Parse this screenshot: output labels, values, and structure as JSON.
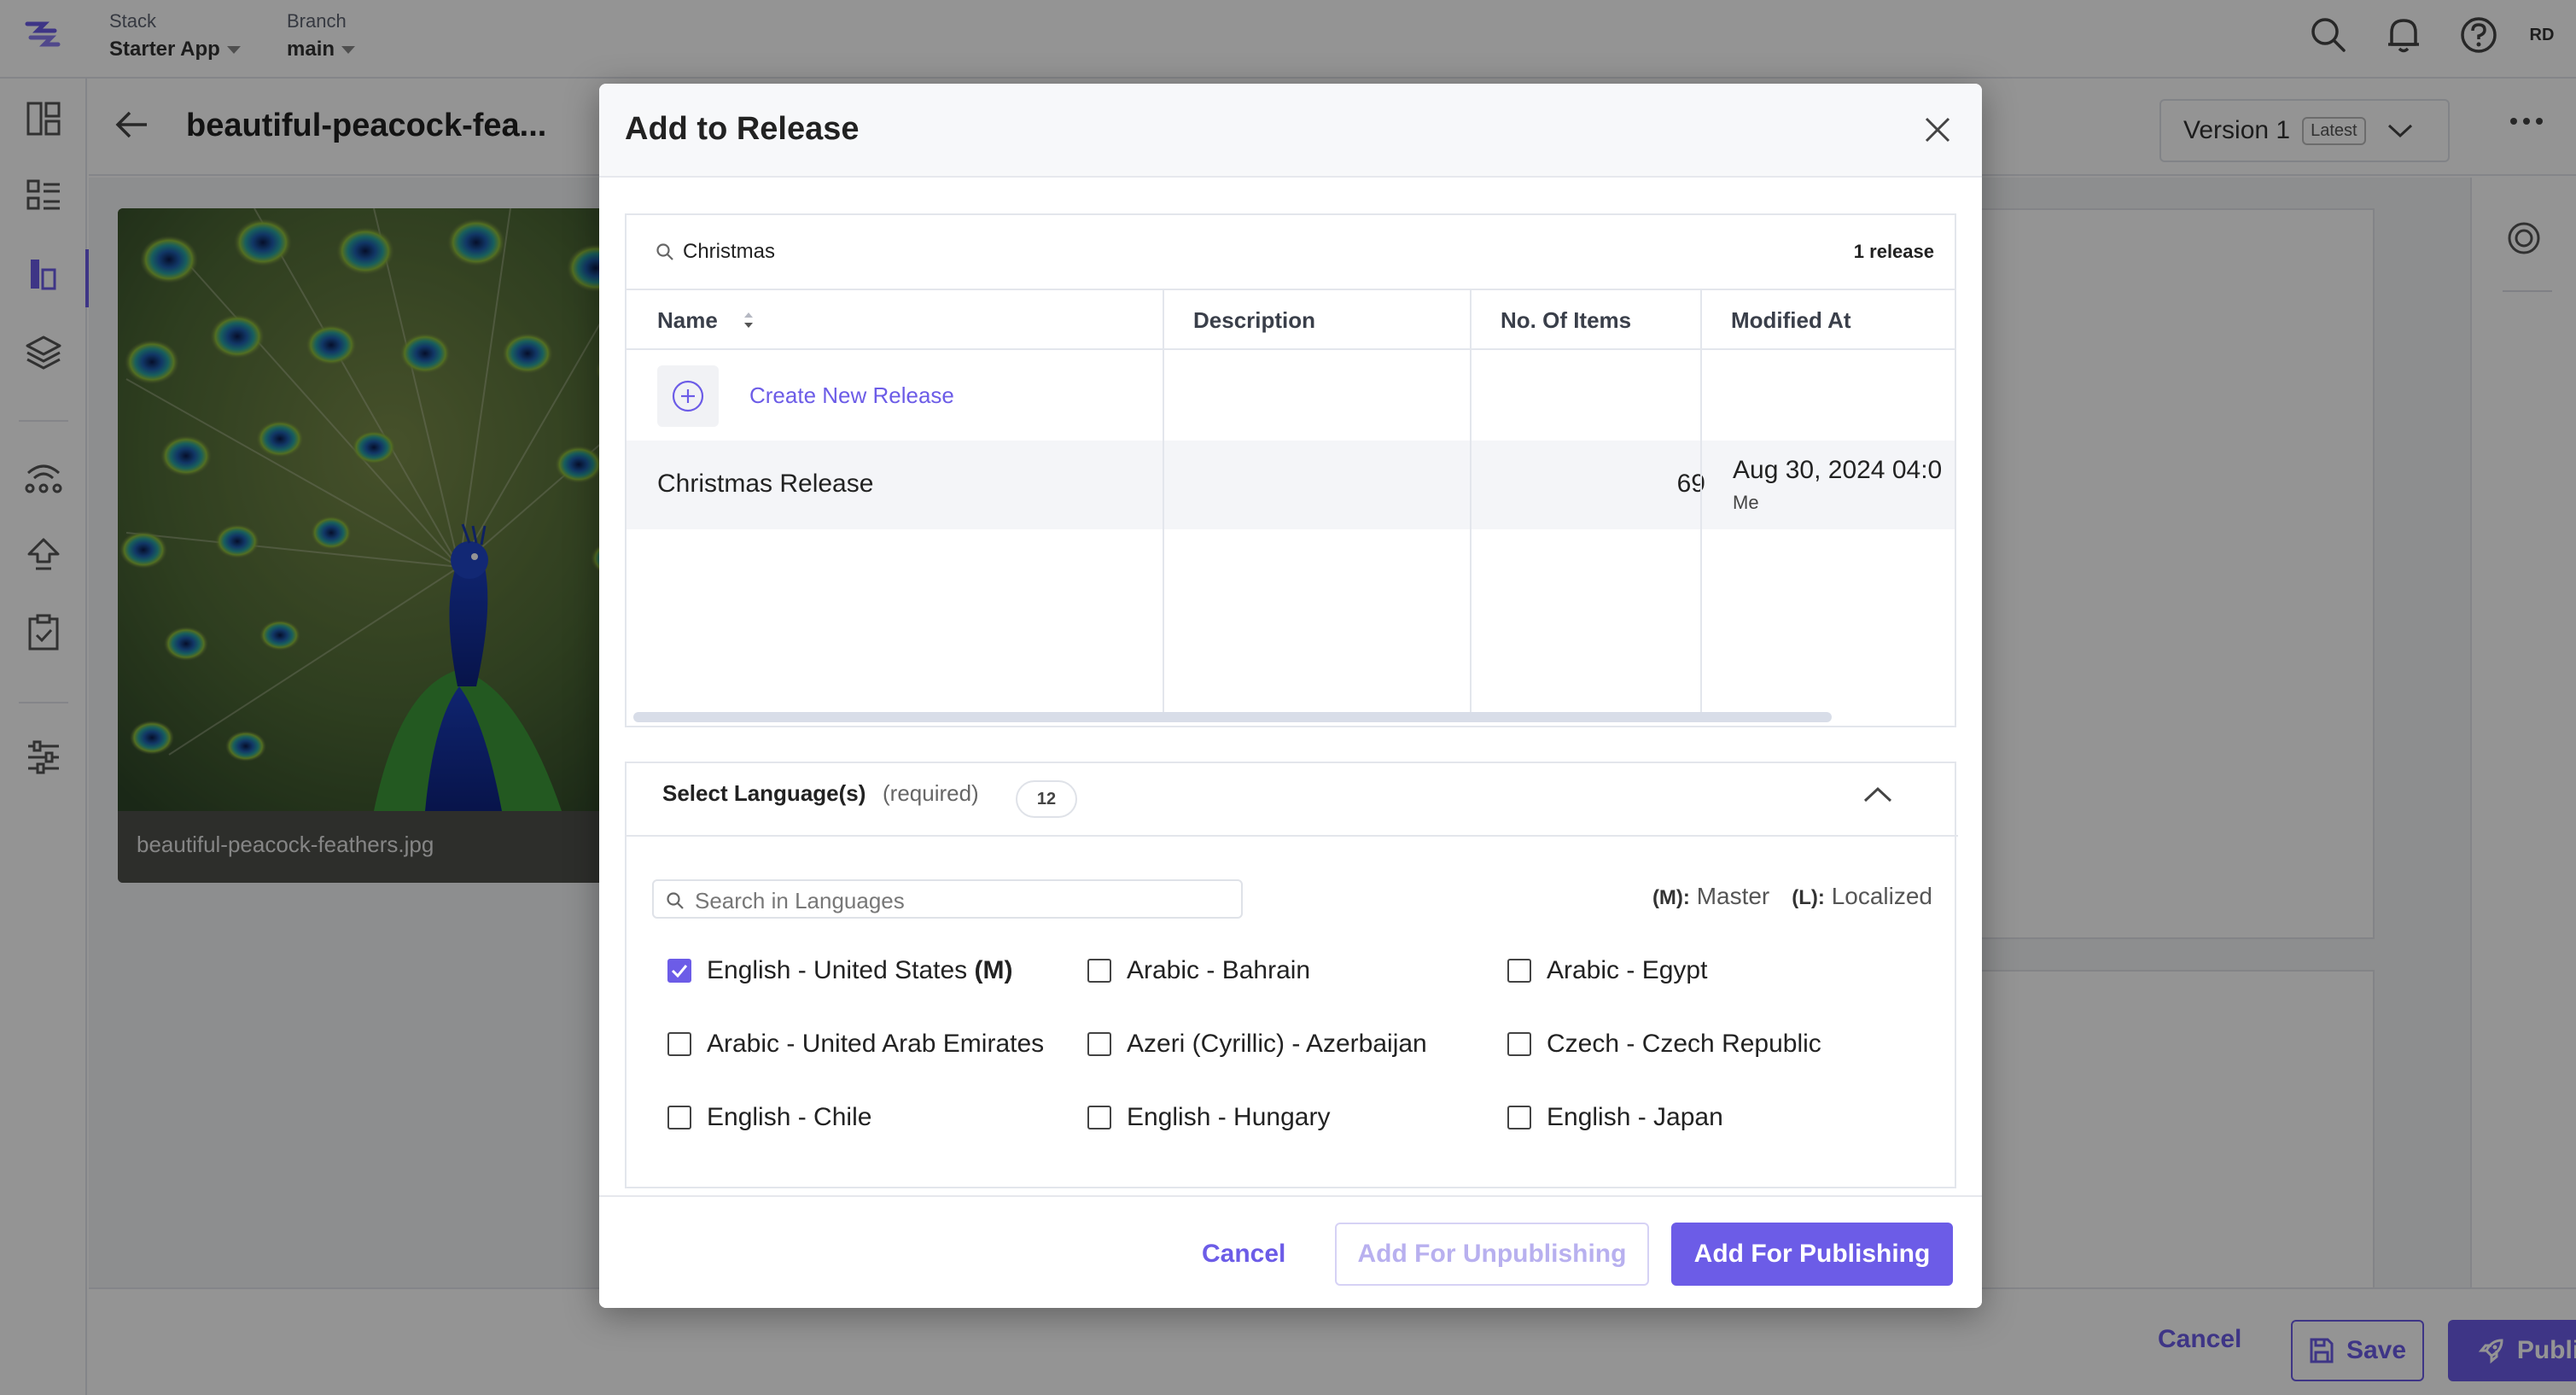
{
  "app": {
    "stack_label": "Stack",
    "stack_value": "Starter App",
    "branch_label": "Branch",
    "branch_value": "main",
    "avatar_initials": "RD",
    "accent_color": "#6c5ce7"
  },
  "icons": {
    "top": [
      "search-icon",
      "bell-icon",
      "help-icon"
    ],
    "sidebar": [
      "dashboard-icon",
      "content-models-icon",
      "entries-icon",
      "assets-icon",
      "releases-icon",
      "deploy-icon",
      "tasks-icon",
      "settings-icon"
    ]
  },
  "entry": {
    "title": "beautiful-peacock-fea...",
    "version_label": "Version 1",
    "latest_badge": "Latest",
    "asset_filename": "beautiful-peacock-feathers.jpg"
  },
  "footer": {
    "cancel_label": "Cancel",
    "save_label": "Save",
    "publish_label": "Publish"
  },
  "modal": {
    "title": "Add to Release",
    "search_value": "Christmas",
    "release_count": "1 release",
    "columns": {
      "name": "Name",
      "description": "Description",
      "items": "No. Of Items",
      "modified": "Modified At"
    },
    "create_new_label": "Create New Release",
    "rows": [
      {
        "name": "Christmas Release",
        "description": "",
        "items": "69",
        "modified_at": "Aug 30, 2024 04:0",
        "modified_by": "Me"
      }
    ],
    "languages": {
      "title": "Select Language(s)",
      "required_note": "(required)",
      "count": "12",
      "search_placeholder": "Search in Languages",
      "legend_master_key": "(M):",
      "legend_master_val": "Master",
      "legend_localized_key": "(L):",
      "legend_localized_val": "Localized",
      "items": [
        {
          "label": "English - United States",
          "tag": "(M)",
          "checked": true
        },
        {
          "label": "Arabic - Bahrain",
          "tag": "",
          "checked": false
        },
        {
          "label": "Arabic - Egypt",
          "tag": "",
          "checked": false
        },
        {
          "label": "Arabic - United Arab Emirates",
          "tag": "",
          "checked": false
        },
        {
          "label": "Azeri (Cyrillic) - Azerbaijan",
          "tag": "",
          "checked": false
        },
        {
          "label": "Czech - Czech Republic",
          "tag": "",
          "checked": false
        },
        {
          "label": "English - Chile",
          "tag": "",
          "checked": false
        },
        {
          "label": "English - Hungary",
          "tag": "",
          "checked": false
        },
        {
          "label": "English - Japan",
          "tag": "",
          "checked": false
        }
      ]
    },
    "cancel_label": "Cancel",
    "unpublish_label": "Add For Unpublishing",
    "publish_label": "Add For Publishing"
  }
}
